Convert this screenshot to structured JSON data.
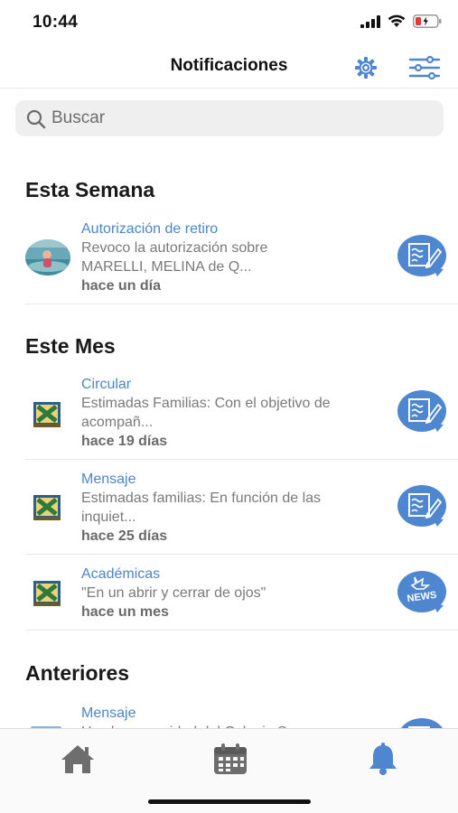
{
  "status_bar": {
    "time": "10:44"
  },
  "header": {
    "title": "Notificaciones"
  },
  "search": {
    "placeholder": "Buscar"
  },
  "sections": {
    "this_week": "Esta Semana",
    "this_month": "Este Mes",
    "earlier": "Anteriores"
  },
  "notifications": [
    {
      "category": "Autorización de retiro",
      "line1": "Revoco la autorización sobre",
      "line2": "MARELLI, MELINA de Q...",
      "time": "hace un día",
      "badge_icon": "document-edit-icon"
    },
    {
      "category": "Circular",
      "line1": "Estimadas Familias:  Con el objetivo de",
      "line2": "acompañ...",
      "time": "hace 19 días",
      "badge_icon": "document-edit-icon"
    },
    {
      "category": "Mensaje",
      "line1": "Estimadas familias:   En función de las",
      "line2": "inquiet...",
      "time": "hace 25 días",
      "badge_icon": "document-edit-icon"
    },
    {
      "category": "Académicas",
      "line1": "\"En un abrir y cerrar de ojos\"",
      "line2": "",
      "time": "hace un mes",
      "badge_icon": "news-icon",
      "badge_text": "NEWS"
    },
    {
      "category": "Mensaje",
      "line1": "Hoy la comunidad del Colegio San",
      "badge_icon": "document-edit-icon"
    }
  ],
  "tabs": [
    {
      "name": "home",
      "icon": "home-icon",
      "active": false
    },
    {
      "name": "calendar",
      "icon": "calendar-icon",
      "active": false
    },
    {
      "name": "notifications",
      "icon": "bell-icon",
      "active": true
    }
  ],
  "colors": {
    "accent": "#4a87c9",
    "badge": "#4f86d0",
    "active_tab": "#4f86d0",
    "inactive_tab": "#6e6e6e"
  }
}
